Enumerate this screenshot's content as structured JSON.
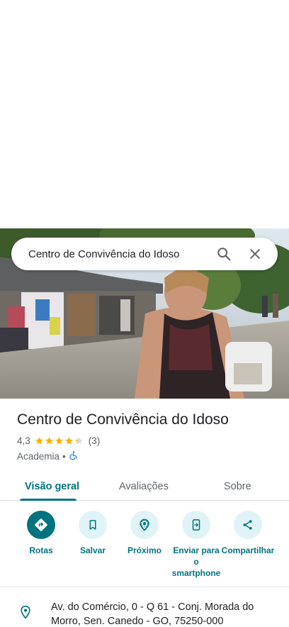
{
  "search": {
    "query": "Centro de Convivência do Idoso"
  },
  "place": {
    "title": "Centro de Convivência do Idoso",
    "rating": "4,3",
    "rating_value": 4.3,
    "review_count": "(3)",
    "category": "Academia",
    "separator": "•"
  },
  "tabs": [
    {
      "label": "Visão geral",
      "active": true
    },
    {
      "label": "Avaliações",
      "active": false
    },
    {
      "label": "Sobre",
      "active": false
    }
  ],
  "actions": [
    {
      "label": "Rotas",
      "icon": "directions-icon"
    },
    {
      "label": "Salvar",
      "icon": "bookmark-icon"
    },
    {
      "label": "Próximo",
      "icon": "nearby-icon"
    },
    {
      "label": "Enviar para o smartphone",
      "icon": "send-to-phone-icon"
    },
    {
      "label": "Compartilhar",
      "icon": "share-icon"
    }
  ],
  "address": {
    "text": "Av. do Comércio, 0 - Q 61 - Conj. Morada do Morro, Sen. Canedo - GO, 75250-000"
  },
  "colors": {
    "accent": "#00737f",
    "action_bg": "#e0f4f7",
    "star": "#f4b400"
  }
}
